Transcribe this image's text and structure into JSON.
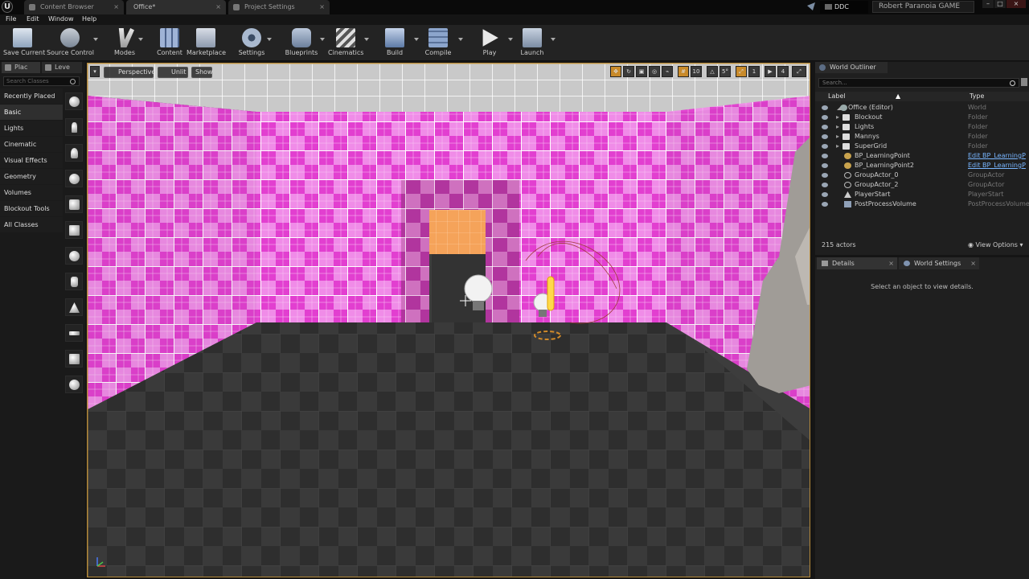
{
  "titlebar": {
    "tabs": [
      {
        "label": "Content Browser"
      },
      {
        "label": "Office*"
      },
      {
        "label": "Project Settings"
      }
    ],
    "ddc_label": "DDC",
    "project_name": "Robert Paranoia GAME"
  },
  "menu": [
    "File",
    "Edit",
    "Window",
    "Help"
  ],
  "toolbar": [
    {
      "label": "Save Current",
      "icon": "save-icon"
    },
    {
      "label": "Source Control",
      "icon": "source-control-icon"
    },
    {
      "label": "Modes",
      "icon": "modes-icon"
    },
    {
      "label": "Content",
      "icon": "content-icon"
    },
    {
      "label": "Marketplace",
      "icon": "marketplace-icon"
    },
    {
      "label": "Settings",
      "icon": "settings-icon"
    },
    {
      "label": "Blueprints",
      "icon": "blueprints-icon"
    },
    {
      "label": "Cinematics",
      "icon": "cinematics-icon"
    },
    {
      "label": "Build",
      "icon": "build-icon"
    },
    {
      "label": "Compile",
      "icon": "compile-icon"
    },
    {
      "label": "Play",
      "icon": "play-icon"
    },
    {
      "label": "Launch",
      "icon": "launch-icon"
    }
  ],
  "left_panel": {
    "tabs": [
      "Plac",
      "Leve"
    ],
    "search_placeholder": "Search Classes",
    "categories": [
      "Recently Placed",
      "Basic",
      "Lights",
      "Cinematic",
      "Visual Effects",
      "Geometry",
      "Volumes",
      "Blockout Tools",
      "All Classes"
    ],
    "selected_category": "Basic"
  },
  "viewport": {
    "view_mode": "Perspective",
    "lighting_mode": "Unlit",
    "show_label": "Show",
    "grid_snap": "10",
    "rotation_snap": "5°",
    "scale_snap": "1",
    "camera_speed": "4"
  },
  "outliner": {
    "title": "World Outliner",
    "search_placeholder": "Search...",
    "col_label": "Label",
    "col_type": "Type",
    "rows": [
      {
        "label": "Office (Editor)",
        "type": "World",
        "kind": "world"
      },
      {
        "label": "Blockout",
        "type": "Folder",
        "kind": "folder"
      },
      {
        "label": "Lights",
        "type": "Folder",
        "kind": "folder"
      },
      {
        "label": "Mannys",
        "type": "Folder",
        "kind": "folder"
      },
      {
        "label": "SuperGrid",
        "type": "Folder",
        "kind": "folder"
      },
      {
        "label": "BP_LearningPoint",
        "type": "Edit BP_LearningP",
        "kind": "bp"
      },
      {
        "label": "BP_LearningPoint2",
        "type": "Edit BP_LearningP",
        "kind": "bp"
      },
      {
        "label": "GroupActor_0",
        "type": "GroupActor",
        "kind": "actor"
      },
      {
        "label": "GroupActor_2",
        "type": "GroupActor",
        "kind": "actor"
      },
      {
        "label": "PlayerStart",
        "type": "PlayerStart",
        "kind": "actor"
      },
      {
        "label": "PostProcessVolume",
        "type": "PostProcessVolume",
        "kind": "actor"
      }
    ],
    "actor_count": "215 actors",
    "view_options": "View Options"
  },
  "details": {
    "tabs": [
      "Details",
      "World Settings"
    ],
    "empty_message": "Select an object to view details."
  },
  "colors": {
    "accent": "#b58a3a",
    "wall_pink": "#e23fd0",
    "wall_light": "#f08ce8",
    "door_orange": "#f5a35a",
    "link_blue": "#79b6ff"
  }
}
